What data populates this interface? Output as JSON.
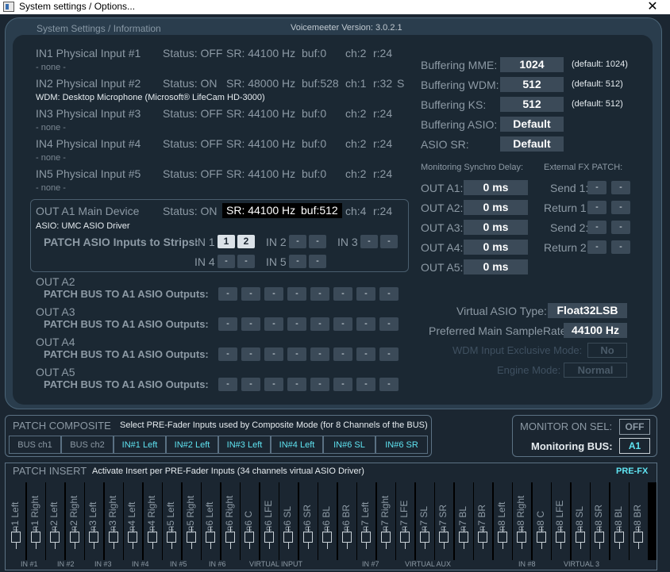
{
  "window": {
    "title": "System settings / Options...",
    "close_glyph": "✕"
  },
  "header": {
    "section": "System Settings / Information",
    "version": "Voicemeeter Version: 3.0.2.1"
  },
  "inputs": [
    {
      "name": "IN1 Physical Input #1",
      "status": "Status: OFF",
      "sr": "SR: 44100 Hz",
      "buf": "buf:0",
      "ch": "ch:2",
      "r": "r:24",
      "extra": "",
      "device": "- none -"
    },
    {
      "name": "IN2 Physical Input #2",
      "status": "Status: ON",
      "sr": "SR: 48000 Hz",
      "buf": "buf:528",
      "ch": "ch:1",
      "r": "r:32",
      "extra": "S",
      "device": "WDM: Desktop Microphone (Microsoft® LifeCam HD-3000)"
    },
    {
      "name": "IN3 Physical Input #3",
      "status": "Status: OFF",
      "sr": "SR: 44100 Hz",
      "buf": "buf:0",
      "ch": "ch:2",
      "r": "r:24",
      "extra": "",
      "device": "- none -"
    },
    {
      "name": "IN4 Physical Input #4",
      "status": "Status: OFF",
      "sr": "SR: 44100 Hz",
      "buf": "buf:0",
      "ch": "ch:2",
      "r": "r:24",
      "extra": "",
      "device": "- none -"
    },
    {
      "name": "IN5 Physical Input #5",
      "status": "Status: OFF",
      "sr": "SR: 44100 Hz",
      "buf": "buf:0",
      "ch": "ch:2",
      "r": "r:24",
      "extra": "",
      "device": "- none -"
    }
  ],
  "outa1": {
    "name": "OUT A1 Main Device",
    "status": "Status: ON",
    "sr": "SR: 44100 Hz",
    "buf": "buf:512",
    "ch": "ch:4",
    "r": "r:24",
    "device": "ASIO: UMC ASIO Driver",
    "patch_label": "PATCH ASIO Inputs to Strips:",
    "strips": [
      {
        "label": "IN 1",
        "buttons": [
          "1",
          "2"
        ]
      },
      {
        "label": "IN 2",
        "buttons": [
          "-",
          "-"
        ]
      },
      {
        "label": "IN 3",
        "buttons": [
          "-",
          "-"
        ]
      },
      {
        "label": "IN 4",
        "buttons": [
          "-",
          "-"
        ]
      },
      {
        "label": "IN 5",
        "buttons": [
          "-",
          "-"
        ]
      }
    ]
  },
  "bus_outputs": [
    {
      "name": "OUT A2",
      "label": "PATCH BUS TO A1 ASIO Outputs:",
      "buttons": [
        "-",
        "-",
        "-",
        "-",
        "-",
        "-",
        "-",
        "-"
      ]
    },
    {
      "name": "OUT A3",
      "label": "PATCH BUS TO A1 ASIO Outputs:",
      "buttons": [
        "-",
        "-",
        "-",
        "-",
        "-",
        "-",
        "-",
        "-"
      ]
    },
    {
      "name": "OUT A4",
      "label": "PATCH BUS TO A1 ASIO Outputs:",
      "buttons": [
        "-",
        "-",
        "-",
        "-",
        "-",
        "-",
        "-",
        "-"
      ]
    },
    {
      "name": "OUT A5",
      "label": "PATCH BUS TO A1 ASIO Outputs:",
      "buttons": [
        "-",
        "-",
        "-",
        "-",
        "-",
        "-",
        "-",
        "-"
      ]
    }
  ],
  "buffering": [
    {
      "label": "Buffering MME:",
      "value": "1024",
      "default": "(default: 1024)"
    },
    {
      "label": "Buffering WDM:",
      "value": "512",
      "default": "(default: 512)"
    },
    {
      "label": "Buffering KS:",
      "value": "512",
      "default": "(default: 512)"
    },
    {
      "label": "Buffering ASIO:",
      "value": "Default",
      "default": ""
    },
    {
      "label": "ASIO SR:",
      "value": "Default",
      "default": ""
    }
  ],
  "sync_delay": {
    "title": "Monitoring Synchro Delay:",
    "rows": [
      {
        "label": "OUT A1:",
        "value": "0 ms"
      },
      {
        "label": "OUT A2:",
        "value": "0 ms"
      },
      {
        "label": "OUT A3:",
        "value": "0 ms"
      },
      {
        "label": "OUT A4:",
        "value": "0 ms"
      },
      {
        "label": "OUT A5:",
        "value": "0 ms"
      }
    ]
  },
  "fx_patch": {
    "title": "External FX PATCH:",
    "rows": [
      {
        "label": "Send 1:",
        "buttons": [
          "-",
          "-"
        ]
      },
      {
        "label": "Return 1:",
        "buttons": [
          "-",
          "-"
        ]
      },
      {
        "label": "Send 2:",
        "buttons": [
          "-",
          "-"
        ]
      },
      {
        "label": "Return 2:",
        "buttons": [
          "-",
          "-"
        ]
      }
    ]
  },
  "virtual_asio": {
    "type_label": "Virtual ASIO Type:",
    "type_value": "Float32LSB",
    "sr_label": "Preferred Main SampleRate:",
    "sr_value": "44100 Hz",
    "wdm_label": "WDM Input Exclusive Mode:",
    "wdm_value": "No",
    "engine_label": "Engine Mode:",
    "engine_value": "Normal"
  },
  "composite": {
    "title": "PATCH COMPOSITE",
    "desc": "Select PRE-Fader Inputs used by Composite Mode (for 8 Channels of the BUS)",
    "buttons": [
      "BUS ch1",
      "BUS ch2",
      "IN#1 Left",
      "IN#2 Left",
      "IN#3 Left",
      "IN#4 Left",
      "IN#6 SL",
      "IN#6 SR"
    ]
  },
  "monitor": {
    "title": "MONITOR ON SEL:",
    "title_value": "OFF",
    "bus_label": "Monitoring BUS:",
    "bus_value": "A1"
  },
  "insert": {
    "title": "PATCH INSERT",
    "desc": "Activate Insert per PRE-Fader Inputs (34 channels virtual ASIO Driver)",
    "mode": "PRE-FX",
    "channels": [
      "in1 Left",
      "in1 Right",
      "in2 Left",
      "in2 Right",
      "in3 Left",
      "in3 Right",
      "in4 Left",
      "in4 Right",
      "in5 Left",
      "in5 Right",
      "in6 Left",
      "in6 Right",
      "in6 C",
      "in6 LFE",
      "in6 SL",
      "in6 SR",
      "in6 BL",
      "in6 BR",
      "in7 Left",
      "in7 Right",
      "in7 LFE",
      "in7 SL",
      "in7 SR",
      "in7 BL",
      "in7 BR",
      "in8 Left",
      "in8 Right",
      "in8 C",
      "in8 LFE",
      "in8 SL",
      "in8 SR",
      "in8 BL",
      "in8 BR"
    ],
    "groups": [
      "IN #1",
      "IN #2",
      "IN #3",
      "IN #4",
      "IN #5",
      "IN #6",
      "VIRTUAL INPUT",
      "IN #7",
      "VIRTUAL AUX",
      "IN #8",
      "VIRTUAL 3"
    ]
  },
  "colors": {
    "background": "#1b2631",
    "panel": "#2a3d4d",
    "accent_cyan": "#5fe4f2",
    "value_box": "#3b4a58",
    "active_button": "#dbe2e8"
  }
}
